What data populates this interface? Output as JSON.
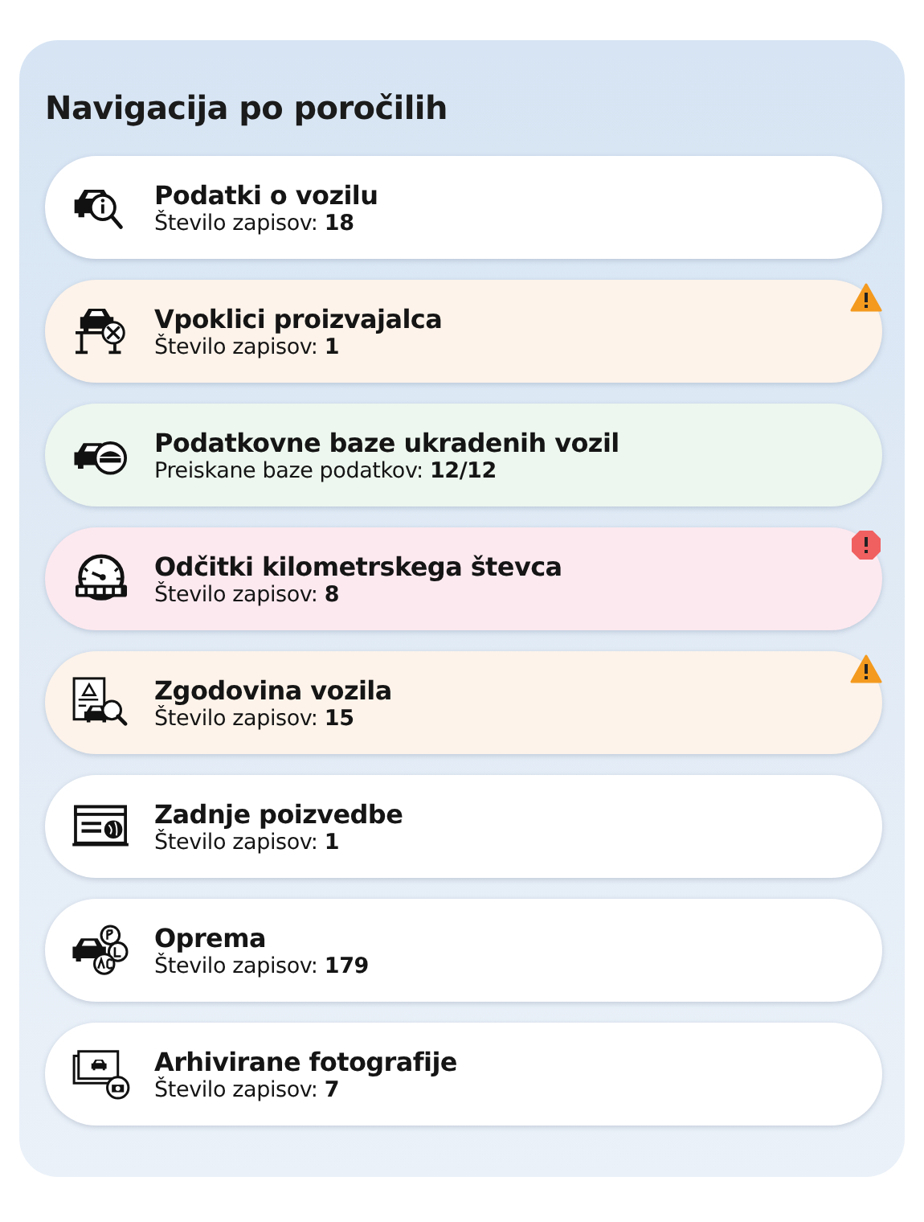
{
  "title": "Navigacija po poročilih",
  "items": [
    {
      "kind": "vehicle-info",
      "title": "Podatki o vozilu",
      "subtitle": "Število zapisov: **18**",
      "color": "#ffffff",
      "warning": false,
      "error": false
    },
    {
      "kind": "recalls",
      "title": "Vpoklici proizvajalca",
      "subtitle": "Število zapisov: **1**",
      "color": "#fdf3ea",
      "warning": true,
      "error": false
    },
    {
      "kind": "stolen",
      "title": "Podatkovne baze ukradenih vozil",
      "subtitle": "Preiskane baze podatkov: **12/12**",
      "color": "#eef7ef",
      "warning": false,
      "error": false
    },
    {
      "kind": "odometer",
      "title": "Odčitki kilometrskega števca",
      "subtitle": "Število zapisov: **8**",
      "color": "#fce8ef",
      "warning": false,
      "error": true
    },
    {
      "kind": "history",
      "title": "Zgodovina vozila",
      "subtitle": "Število zapisov: **15**",
      "color": "#fdf3ea",
      "warning": true,
      "error": false
    },
    {
      "kind": "searches",
      "title": "Zadnje poizvedbe",
      "subtitle": "Število zapisov: **1**",
      "color": "#ffffff",
      "warning": false,
      "error": false
    },
    {
      "kind": "equipment",
      "title": "Oprema",
      "subtitle": "Število zapisov: **179**",
      "color": "#ffffff",
      "warning": false,
      "error": false
    },
    {
      "kind": "photos",
      "title": "Arhivirane fotografije",
      "subtitle": "Število zapisov: **7**",
      "color": "#ffffff",
      "warning": false,
      "error": false
    }
  ]
}
